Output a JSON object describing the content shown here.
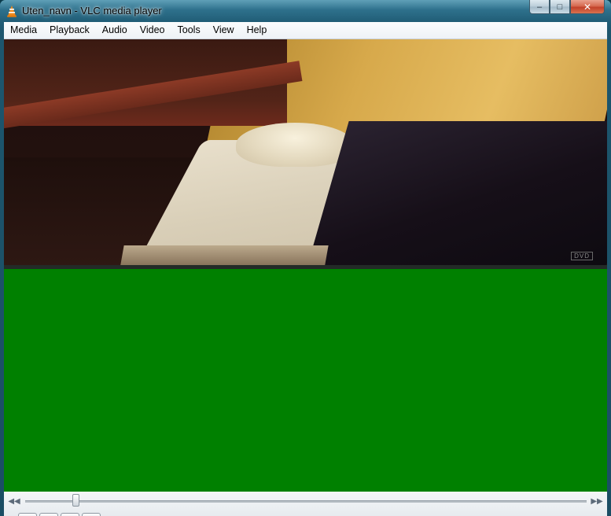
{
  "window": {
    "title": "Uten_navn - VLC media player",
    "controls": {
      "minimize": "–",
      "maximize": "□",
      "close": "✕"
    }
  },
  "menubar": {
    "items": [
      "Media",
      "Playback",
      "Audio",
      "Video",
      "Tools",
      "View",
      "Help"
    ]
  },
  "video": {
    "logo_text": "DVD"
  },
  "green_area_color": "#008000",
  "controls": {
    "prev_icon": "◀◀",
    "next_icon": "▶▶",
    "seek_position": 0.09
  },
  "icons": {
    "app": "vlc-cone-icon",
    "prev": "rewind-icon",
    "next": "fast-forward-icon"
  }
}
